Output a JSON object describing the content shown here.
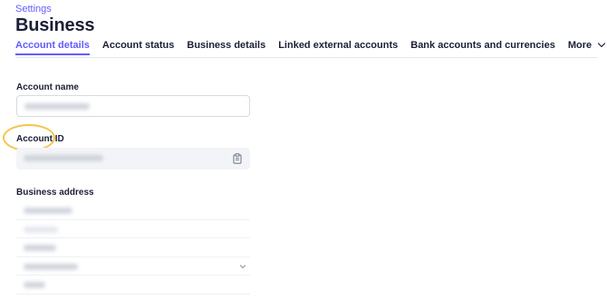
{
  "breadcrumb": "Settings",
  "page_title": "Business",
  "tabs": [
    {
      "label": "Account details",
      "active": true
    },
    {
      "label": "Account status",
      "active": false
    },
    {
      "label": "Business details",
      "active": false
    },
    {
      "label": "Linked external accounts",
      "active": false
    },
    {
      "label": "Bank accounts and currencies",
      "active": false
    },
    {
      "label": "More",
      "active": false
    }
  ],
  "fields": {
    "account_name_label": "Account name",
    "account_id_label": "Account ID",
    "business_address_label": "Business address"
  },
  "icons": {
    "copy": "clipboard-icon",
    "more": "chevron-down-icon",
    "state_select": "chevron-down-icon"
  },
  "colors": {
    "accent": "#635bff",
    "highlight": "#f4c54a",
    "text": "#1a1f36",
    "readonly_bg": "#f2f4f7"
  }
}
